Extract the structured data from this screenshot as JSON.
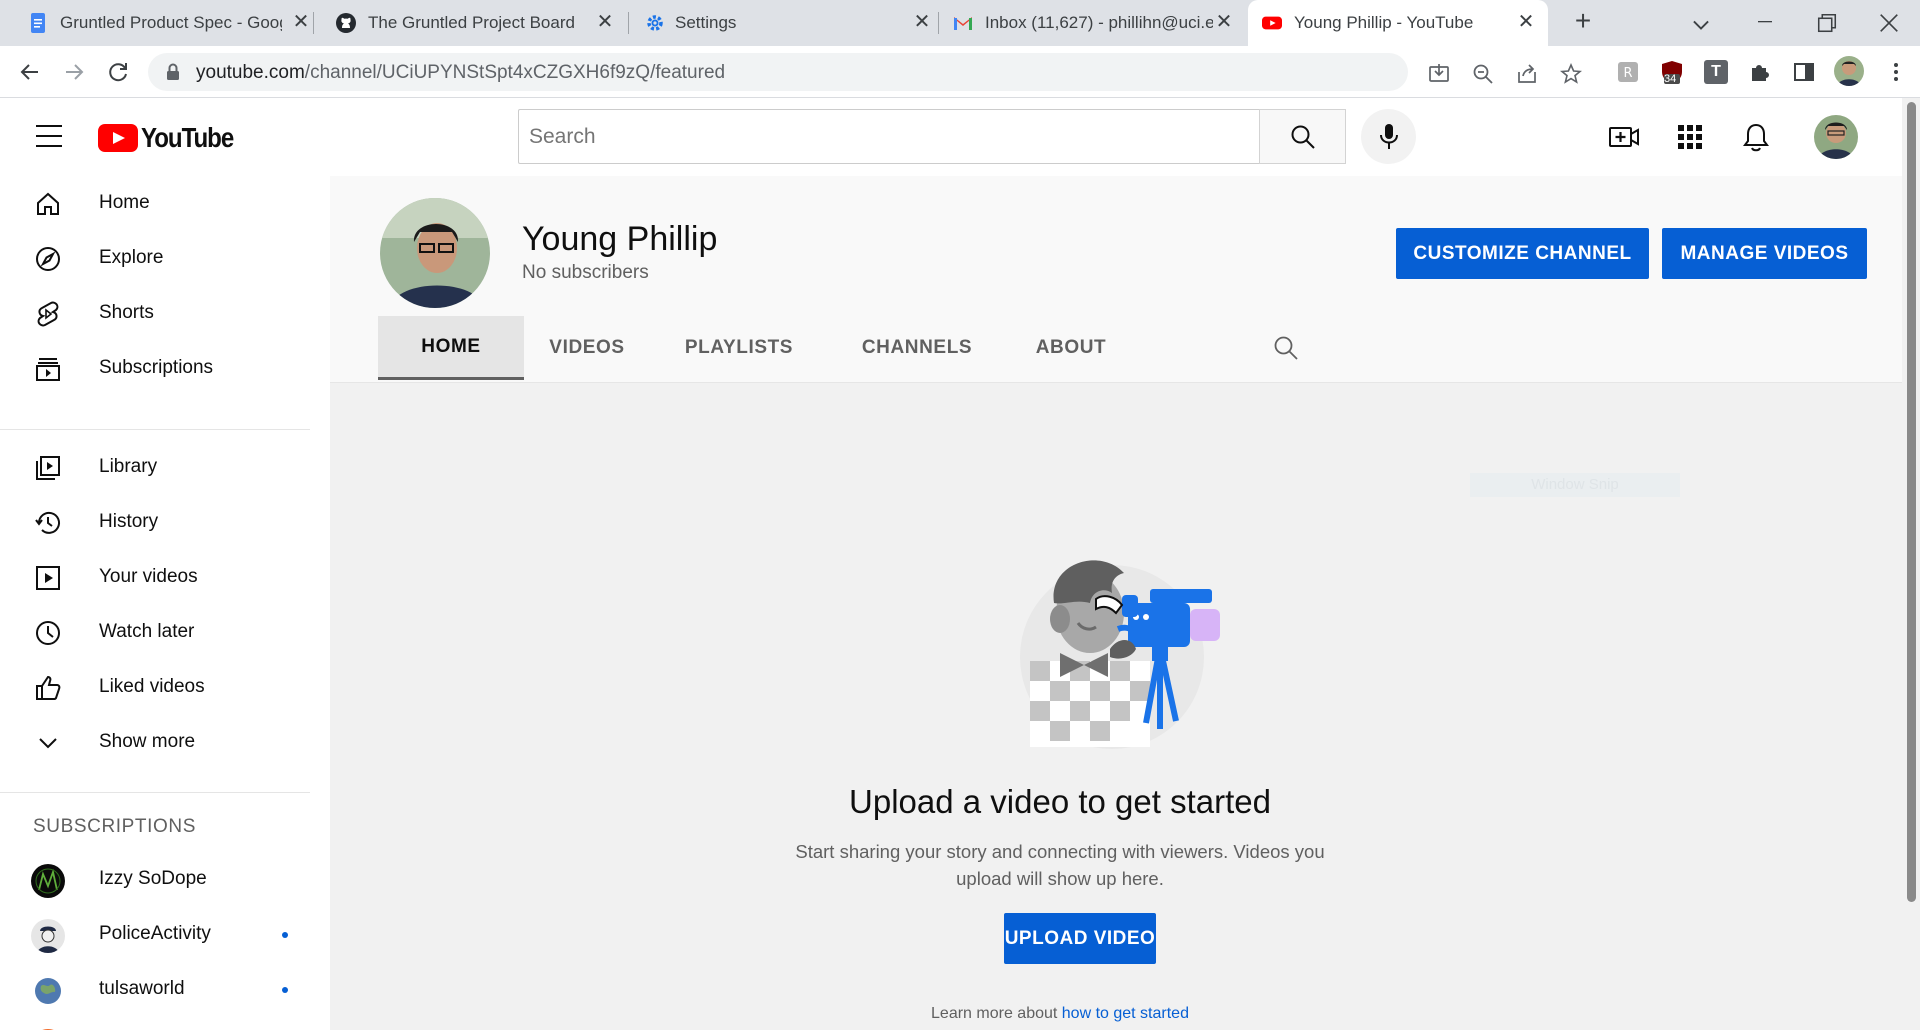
{
  "browser": {
    "tabs": [
      {
        "title": "Gruntled Product Spec - Goog",
        "icon": "google-docs-icon",
        "active": false
      },
      {
        "title": "The Gruntled Project Board",
        "icon": "github-icon",
        "active": false
      },
      {
        "title": "Settings",
        "icon": "gear-icon",
        "active": false
      },
      {
        "title": "Inbox (11,627) - phillihn@uci.e",
        "icon": "gmail-icon",
        "active": false
      },
      {
        "title": "Young Phillip - YouTube",
        "icon": "youtube-icon",
        "active": true
      }
    ],
    "new_tab_label": "+",
    "url_host": "youtube.com",
    "url_path": "/channel/UCiUPYNStSpt4xCZGXH6f9zQ/featured",
    "extension_badge": "34",
    "extension_letter": "T"
  },
  "masthead": {
    "logo_text": "YouTube",
    "search_placeholder": "Search"
  },
  "sidebar": {
    "main": [
      {
        "label": "Home",
        "icon": "home-icon"
      },
      {
        "label": "Explore",
        "icon": "compass-icon"
      },
      {
        "label": "Shorts",
        "icon": "shorts-icon"
      },
      {
        "label": "Subscriptions",
        "icon": "subscriptions-icon"
      }
    ],
    "library": [
      {
        "label": "Library",
        "icon": "library-icon"
      },
      {
        "label": "History",
        "icon": "history-icon"
      },
      {
        "label": "Your videos",
        "icon": "your-videos-icon"
      },
      {
        "label": "Watch later",
        "icon": "clock-icon"
      },
      {
        "label": "Liked videos",
        "icon": "thumbs-up-icon"
      },
      {
        "label": "Show more",
        "icon": "chevron-down-icon"
      }
    ],
    "subscriptions_heading": "SUBSCRIPTIONS",
    "subscriptions": [
      {
        "label": "Izzy SoDope",
        "new_content": false
      },
      {
        "label": "PoliceActivity",
        "new_content": true
      },
      {
        "label": "tulsaworld",
        "new_content": true
      }
    ]
  },
  "channel": {
    "name": "Young Phillip",
    "subscribers": "No subscribers",
    "customize_label": "CUSTOMIZE CHANNEL",
    "manage_label": "MANAGE VIDEOS",
    "tabs": [
      "HOME",
      "VIDEOS",
      "PLAYLISTS",
      "CHANNELS",
      "ABOUT"
    ],
    "active_tab": "HOME"
  },
  "empty_state": {
    "title": "Upload a video to get started",
    "description": "Start sharing your story and connecting with viewers. Videos you upload will show up here.",
    "upload_label": "UPLOAD VIDEO",
    "learn_more_prefix": "Learn more about ",
    "learn_more_link": "how to get started",
    "overlay_text": "Window Snip"
  },
  "colors": {
    "accent_blue": "#065fd4",
    "youtube_red": "#ff0000",
    "tabbar": "#dee1e6",
    "page_bg": "#f9f9f9"
  }
}
